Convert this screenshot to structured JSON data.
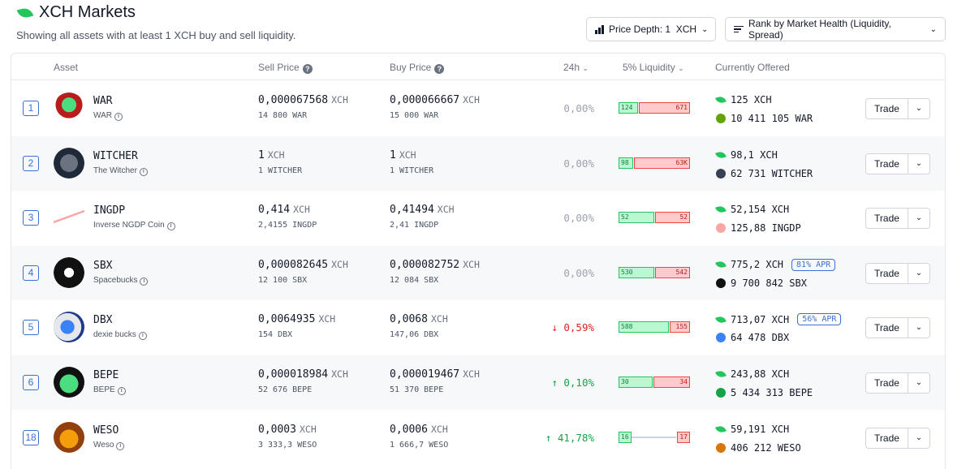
{
  "header": {
    "title": "XCH Markets",
    "subtitle": "Showing all assets with at least 1 XCH buy and sell liquidity.",
    "depth_label": "Price Depth: 1  XCH",
    "rank_label": "Rank by Market Health (Liquidity, Spread)"
  },
  "columns": {
    "asset": "Asset",
    "sell": "Sell Price",
    "buy": "Buy Price",
    "change": "24h",
    "liquidity": "5% Liquidity",
    "offered": "Currently Offered"
  },
  "trade_label": "Trade",
  "rows": [
    {
      "rank": "1",
      "name": "WAR",
      "sub": "WAR",
      "sell": "0,000067568",
      "sell_unit": "XCH",
      "sell_sub": "14 800 WAR",
      "buy": "0,000066667",
      "buy_unit": "XCH",
      "buy_sub": "15 000 WAR",
      "change": "0,00%",
      "liq_buy": "124",
      "liq_sell": "671",
      "offer_xch": "125 XCH",
      "offer_token": "10 411 105 WAR",
      "apr": ""
    },
    {
      "rank": "2",
      "name": "WITCHER",
      "sub": "The Witcher",
      "sell": "1",
      "sell_unit": "XCH",
      "sell_sub": "1 WITCHER",
      "buy": "1",
      "buy_unit": "XCH",
      "buy_sub": "1 WITCHER",
      "change": "0,00%",
      "liq_buy": "98",
      "liq_sell": "63K",
      "offer_xch": "98,1 XCH",
      "offer_token": "62 731 WITCHER",
      "apr": ""
    },
    {
      "rank": "3",
      "name": "INGDP",
      "sub": "Inverse NGDP Coin",
      "sell": "0,414",
      "sell_unit": "XCH",
      "sell_sub": "2,4155 INGDP",
      "buy": "0,41494",
      "buy_unit": "XCH",
      "buy_sub": "2,41 INGDP",
      "change": "0,00%",
      "liq_buy": "52",
      "liq_sell": "52",
      "offer_xch": "52,154 XCH",
      "offer_token": "125,88 INGDP",
      "apr": ""
    },
    {
      "rank": "4",
      "name": "SBX",
      "sub": "Spacebucks",
      "sell": "0,000082645",
      "sell_unit": "XCH",
      "sell_sub": "12 100 SBX",
      "buy": "0,000082752",
      "buy_unit": "XCH",
      "buy_sub": "12 084 SBX",
      "change": "0,00%",
      "liq_buy": "530",
      "liq_sell": "542",
      "offer_xch": "775,2 XCH",
      "offer_token": "9 700 842 SBX",
      "apr": "81% APR"
    },
    {
      "rank": "5",
      "name": "DBX",
      "sub": "dexie bucks",
      "sell": "0,0064935",
      "sell_unit": "XCH",
      "sell_sub": "154 DBX",
      "buy": "0,0068",
      "buy_unit": "XCH",
      "buy_sub": "147,06 DBX",
      "change": "↓ 0,59%",
      "liq_buy": "588",
      "liq_sell": "155",
      "offer_xch": "713,07 XCH",
      "offer_token": "64 478 DBX",
      "apr": "56% APR"
    },
    {
      "rank": "6",
      "name": "BEPE",
      "sub": "BEPE",
      "sell": "0,000018984",
      "sell_unit": "XCH",
      "sell_sub": "52 676 BEPE",
      "buy": "0,000019467",
      "buy_unit": "XCH",
      "buy_sub": "51 370 BEPE",
      "change": "↑ 0,10%",
      "liq_buy": "30",
      "liq_sell": "34",
      "offer_xch": "243,88 XCH",
      "offer_token": "5 434 313 BEPE",
      "apr": ""
    },
    {
      "rank": "18",
      "name": "WESO",
      "sub": "Weso",
      "sell": "0,0003",
      "sell_unit": "XCH",
      "sell_sub": "3 333,3 WESO",
      "buy": "0,0006",
      "buy_unit": "XCH",
      "buy_sub": "1 666,7 WESO",
      "change": "↑ 41,78%",
      "liq_buy": "16",
      "liq_sell": "17",
      "offer_xch": "59,191 XCH",
      "offer_token": "406 212 WESO",
      "apr": ""
    }
  ]
}
